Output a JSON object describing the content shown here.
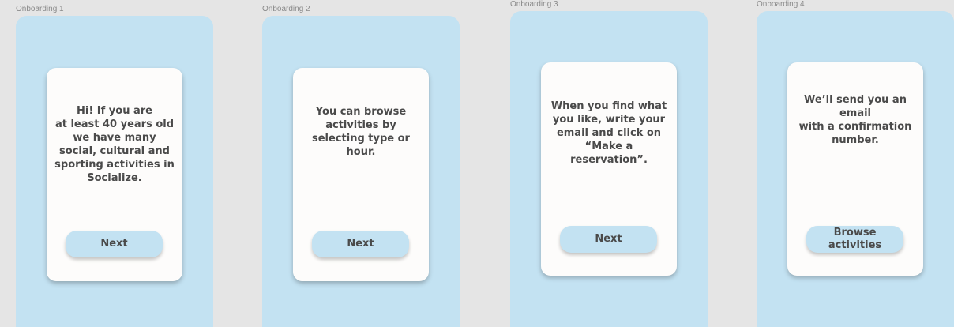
{
  "canvas_background": "#e5e5e5",
  "colors": {
    "frame_bg": "#c3e2f2",
    "card_bg": "#fdfcfb",
    "text": "#4a4a4a",
    "label": "#8a8a8a"
  },
  "screens": [
    {
      "label": "Onboarding 1",
      "text": "Hi! If you are\nat least 40 years old\nwe have many\nsocial, cultural and\nsporting activities in\nSocialize.",
      "button": "Next"
    },
    {
      "label": "Onboarding 2",
      "text": "You can browse\nactivities by\nselecting type or\nhour.",
      "button": "Next"
    },
    {
      "label": "Onboarding 3",
      "text": "When you find what\nyou like, write your\nemail and click on\n“Make a reservation”.",
      "button": "Next"
    },
    {
      "label": "Onboarding 4",
      "text": "We’ll send you an\nemail\nwith a confirmation\nnumber.",
      "button": "Browse\nactivities"
    }
  ]
}
